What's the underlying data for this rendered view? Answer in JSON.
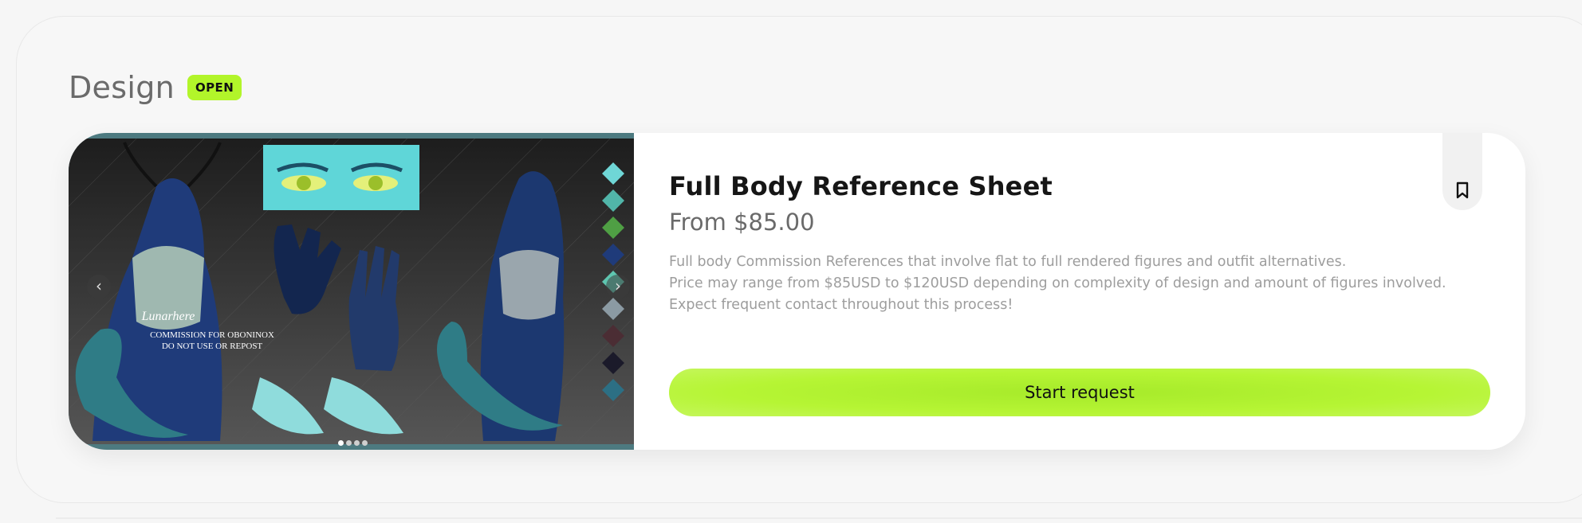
{
  "section": {
    "title": "Design",
    "status": "OPEN"
  },
  "card": {
    "title": "Full Body Reference Sheet",
    "price": "From $85.00",
    "description": [
      "Full body Commission References that involve flat to full rendered figures and outfit alternatives.",
      "Price may range from $85USD to $120USD depending on complexity of design and amount of figures involved.",
      "Expect frequent contact throughout this process!"
    ],
    "cta_label": "Start request",
    "gallery": {
      "total_images": 4,
      "active_index": 0,
      "watermark": [
        "Lunarhere",
        "COMMISSION FOR OBONINOX",
        "DO NOT USE OR REPOST"
      ]
    }
  },
  "colors": {
    "accent": "#b2f52a",
    "gallery_frame": "#4d7a80"
  },
  "icons": {
    "prev": "chevron-left-icon",
    "next": "chevron-right-icon",
    "bookmark": "bookmark-icon"
  }
}
